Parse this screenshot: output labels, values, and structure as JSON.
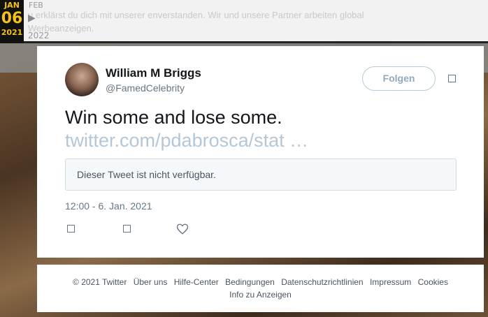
{
  "wayback": {
    "current_month": "JAN",
    "current_day": "06",
    "current_year": "2021",
    "next_month": "FEB",
    "next_arrow": "▶",
    "next_year": "2022"
  },
  "cookie_banner": {
    "text": "u erklärst du dich mit unserer                     enverstanden. Wir und unsere Partner arbeiten global",
    "text2": "Werbeanzeigen."
  },
  "tweet": {
    "author_name": "William M Briggs",
    "author_handle": "@FamedCelebrity",
    "follow_label": "Folgen",
    "text": "Win some and lose some.",
    "link": "twitter.com/pdabrosca/stat …",
    "quoted_unavailable": "Dieser Tweet ist nicht verfügbar.",
    "timestamp": "12:00 - 6. Jan. 2021"
  },
  "footer": {
    "links": [
      "© 2021 Twitter",
      "Über uns",
      "Hilfe-Center",
      "Bedingungen",
      "Datenschutzrichtlinien",
      "Impressum",
      "Cookies"
    ],
    "links2": [
      "Info zu Anzeigen"
    ]
  },
  "colors": {
    "accent": "#f5c218",
    "link": "#b4c7d6",
    "text": "#14171a"
  }
}
